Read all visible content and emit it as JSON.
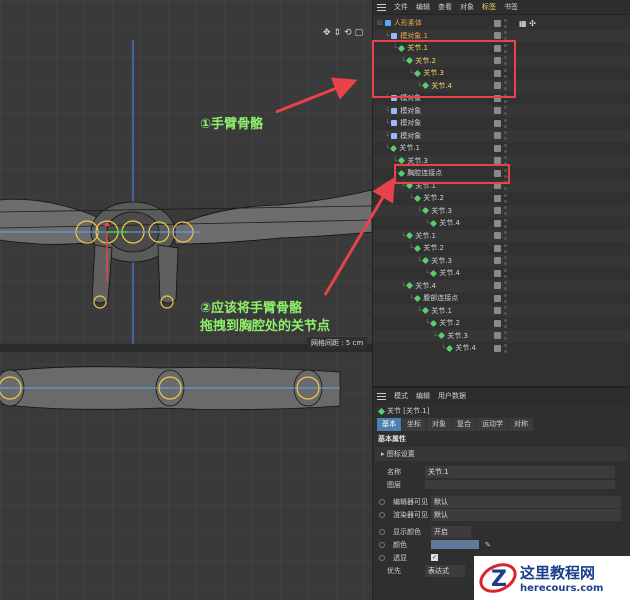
{
  "object_manager": {
    "menu": [
      "文件",
      "编辑",
      "查看",
      "对象",
      "标签",
      "书签"
    ],
    "active_menu": "标签",
    "rows": [
      {
        "label": "人形素体",
        "type": "figure",
        "indent": 0,
        "style": "sel",
        "tags": "▦ ✣"
      },
      {
        "label": "模对象.1",
        "type": "null",
        "indent": 1,
        "style": "sel"
      },
      {
        "label": "关节.1",
        "type": "joint",
        "indent": 2,
        "style": "hi"
      },
      {
        "label": "关节.2",
        "type": "joint",
        "indent": 3,
        "style": "hi"
      },
      {
        "label": "关节.3",
        "type": "joint",
        "indent": 4,
        "style": "hi"
      },
      {
        "label": "关节.4",
        "type": "joint",
        "indent": 5,
        "style": "hi"
      },
      {
        "label": "模对象",
        "type": "null",
        "indent": 1,
        "style": ""
      },
      {
        "label": "模对象",
        "type": "null",
        "indent": 1,
        "style": ""
      },
      {
        "label": "模对象",
        "type": "null",
        "indent": 1,
        "style": ""
      },
      {
        "label": "模对象",
        "type": "null",
        "indent": 1,
        "style": ""
      },
      {
        "label": "关节.1",
        "type": "joint",
        "indent": 1,
        "style": ""
      },
      {
        "label": "关节.3",
        "type": "joint",
        "indent": 2,
        "style": ""
      },
      {
        "label": "胸腔连接点",
        "type": "joint",
        "indent": 2,
        "style": ""
      },
      {
        "label": "关节.1",
        "type": "joint",
        "indent": 3,
        "style": ""
      },
      {
        "label": "关节.2",
        "type": "joint",
        "indent": 4,
        "style": ""
      },
      {
        "label": "关节.3",
        "type": "joint",
        "indent": 5,
        "style": ""
      },
      {
        "label": "关节.4",
        "type": "joint",
        "indent": 6,
        "style": ""
      },
      {
        "label": "关节.1",
        "type": "joint",
        "indent": 3,
        "style": ""
      },
      {
        "label": "关节.2",
        "type": "joint",
        "indent": 4,
        "style": ""
      },
      {
        "label": "关节.3",
        "type": "joint",
        "indent": 5,
        "style": ""
      },
      {
        "label": "关节.4",
        "type": "joint",
        "indent": 6,
        "style": ""
      },
      {
        "label": "关节.4",
        "type": "joint",
        "indent": 3,
        "style": ""
      },
      {
        "label": "腹部连接点",
        "type": "joint",
        "indent": 4,
        "style": ""
      },
      {
        "label": "关节.1",
        "type": "joint",
        "indent": 5,
        "style": ""
      },
      {
        "label": "关节.2",
        "type": "joint",
        "indent": 6,
        "style": ""
      },
      {
        "label": "关节.3",
        "type": "joint",
        "indent": 7,
        "style": ""
      },
      {
        "label": "关节.4",
        "type": "joint",
        "indent": 8,
        "style": ""
      }
    ]
  },
  "attribute_manager": {
    "menu": [
      "模式",
      "编辑",
      "用户数据"
    ],
    "object_title": "关节 [关节.1]",
    "tabs": [
      "基本",
      "坐标",
      "对象",
      "复合",
      "运动学",
      "对称"
    ],
    "active_tab": "基本",
    "section": "基本属性",
    "group": "图标设置",
    "fields": {
      "name_label": "名称",
      "name_value": "关节.1",
      "layer_label": "图层",
      "layer_value": "",
      "editor_vis_label": "编辑器可见",
      "editor_vis_value": "默认",
      "render_vis_label": "渲染器可见",
      "render_vis_value": "默认",
      "display_color_label": "显示颜色",
      "display_color_value": "开启",
      "color_label": "颜色",
      "transparent_label": "透显",
      "priority_label": "优先",
      "priority_value": "表达式"
    },
    "color_swatch": "#5b7aa1"
  },
  "viewport": {
    "grid_spacing": "网格间距 : 5 cm"
  },
  "annotations": {
    "note1": "①手臂骨骼",
    "note2_line1": "②应该将手臂骨骼",
    "note2_line2": "拖拽到胸腔处的关节点",
    "accent": "#e8434a",
    "text_color": "#8ff06b"
  },
  "watermark": {
    "title": "这里教程网",
    "url": "herecours.com"
  }
}
